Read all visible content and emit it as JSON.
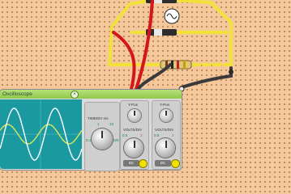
{
  "window": {
    "title": "Oscilloscope",
    "close_glyph": "×"
  },
  "timebase": {
    "label": "TIMEDIV ms",
    "scale_low": "1",
    "scale_high": "10",
    "scale_mid_left": "0.1",
    "scale_mid_right": "100"
  },
  "channel_a": {
    "ypos_label": "Y-Pos",
    "voltsdiv_label": "VOLTS/DIV",
    "scale_low": "0.5",
    "scale_high": "2",
    "button_label": "DC"
  },
  "channel_b": {
    "ypos_label": "Y-Pos",
    "voltsdiv_label": "VOLTS/DIV",
    "scale_low": "0.5",
    "scale_high": "2",
    "button_label": "DC"
  },
  "colors": {
    "trace_a": "#d9e85a",
    "trace_b": "#ffffff",
    "wire_red": "#d4151b",
    "wire_black": "#3a3a3a",
    "wire_yellow": "#f1e13a"
  }
}
